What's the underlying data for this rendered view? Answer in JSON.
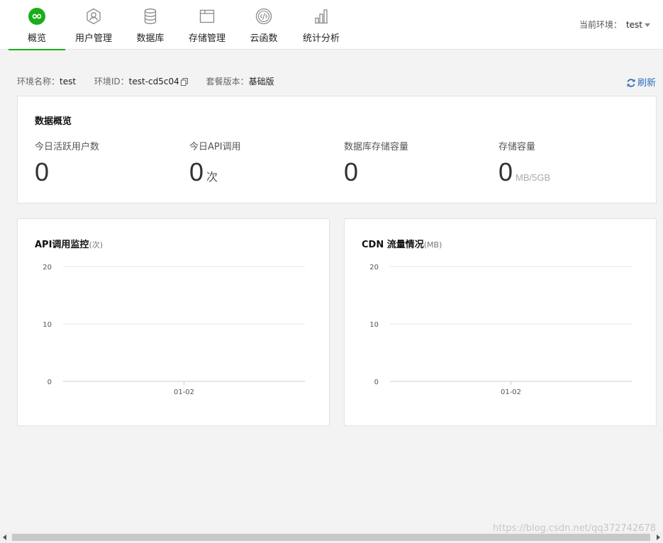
{
  "nav": {
    "tabs": [
      {
        "label": "概览",
        "icon": "overview-infinity-icon",
        "active": true
      },
      {
        "label": "用户管理",
        "icon": "user-icon",
        "active": false
      },
      {
        "label": "数据库",
        "icon": "database-icon",
        "active": false
      },
      {
        "label": "存储管理",
        "icon": "storage-folder-icon",
        "active": false
      },
      {
        "label": "云函数",
        "icon": "cloud-function-icon",
        "active": false
      },
      {
        "label": "统计分析",
        "icon": "bar-chart-icon",
        "active": false
      }
    ],
    "env_label": "当前环境：",
    "env_value": "test"
  },
  "info": {
    "env_name_label": "环境名称：",
    "env_name": "test",
    "env_id_label": "环境ID：",
    "env_id": "test-cd5c04",
    "plan_label": "套餐版本：",
    "plan": "基础版",
    "refresh": "刷新"
  },
  "overview": {
    "title": "数据概览",
    "stats": [
      {
        "label": "今日活跃用户数",
        "value": "0",
        "unit": ""
      },
      {
        "label": "今日API调用",
        "value": "0",
        "unit": "次"
      },
      {
        "label": "数据库存储容量",
        "value": "0",
        "unit": ""
      },
      {
        "label": "存储容量",
        "value": "0",
        "unit": "MB/5GB"
      }
    ]
  },
  "charts": {
    "api": {
      "title": "API调用监控",
      "unit": "(次)"
    },
    "cdn": {
      "title": "CDN 流量情况",
      "unit": "(MB)"
    }
  },
  "chart_data": [
    {
      "type": "line",
      "title": "API调用监控(次)",
      "x": [
        "01-02"
      ],
      "series": [
        {
          "values": [
            0
          ]
        }
      ],
      "ylim": [
        0,
        20
      ],
      "yticks": [
        0,
        10,
        20
      ],
      "grid": true
    },
    {
      "type": "line",
      "title": "CDN 流量情况(MB)",
      "x": [
        "01-02"
      ],
      "series": [
        {
          "values": [
            0
          ]
        }
      ],
      "ylim": [
        0,
        20
      ],
      "yticks": [
        0,
        10,
        20
      ],
      "grid": true
    }
  ],
  "watermark": "https://blog.csdn.net/qq372742678",
  "colors": {
    "accent": "#1aad19",
    "link": "#2d6fbf"
  }
}
